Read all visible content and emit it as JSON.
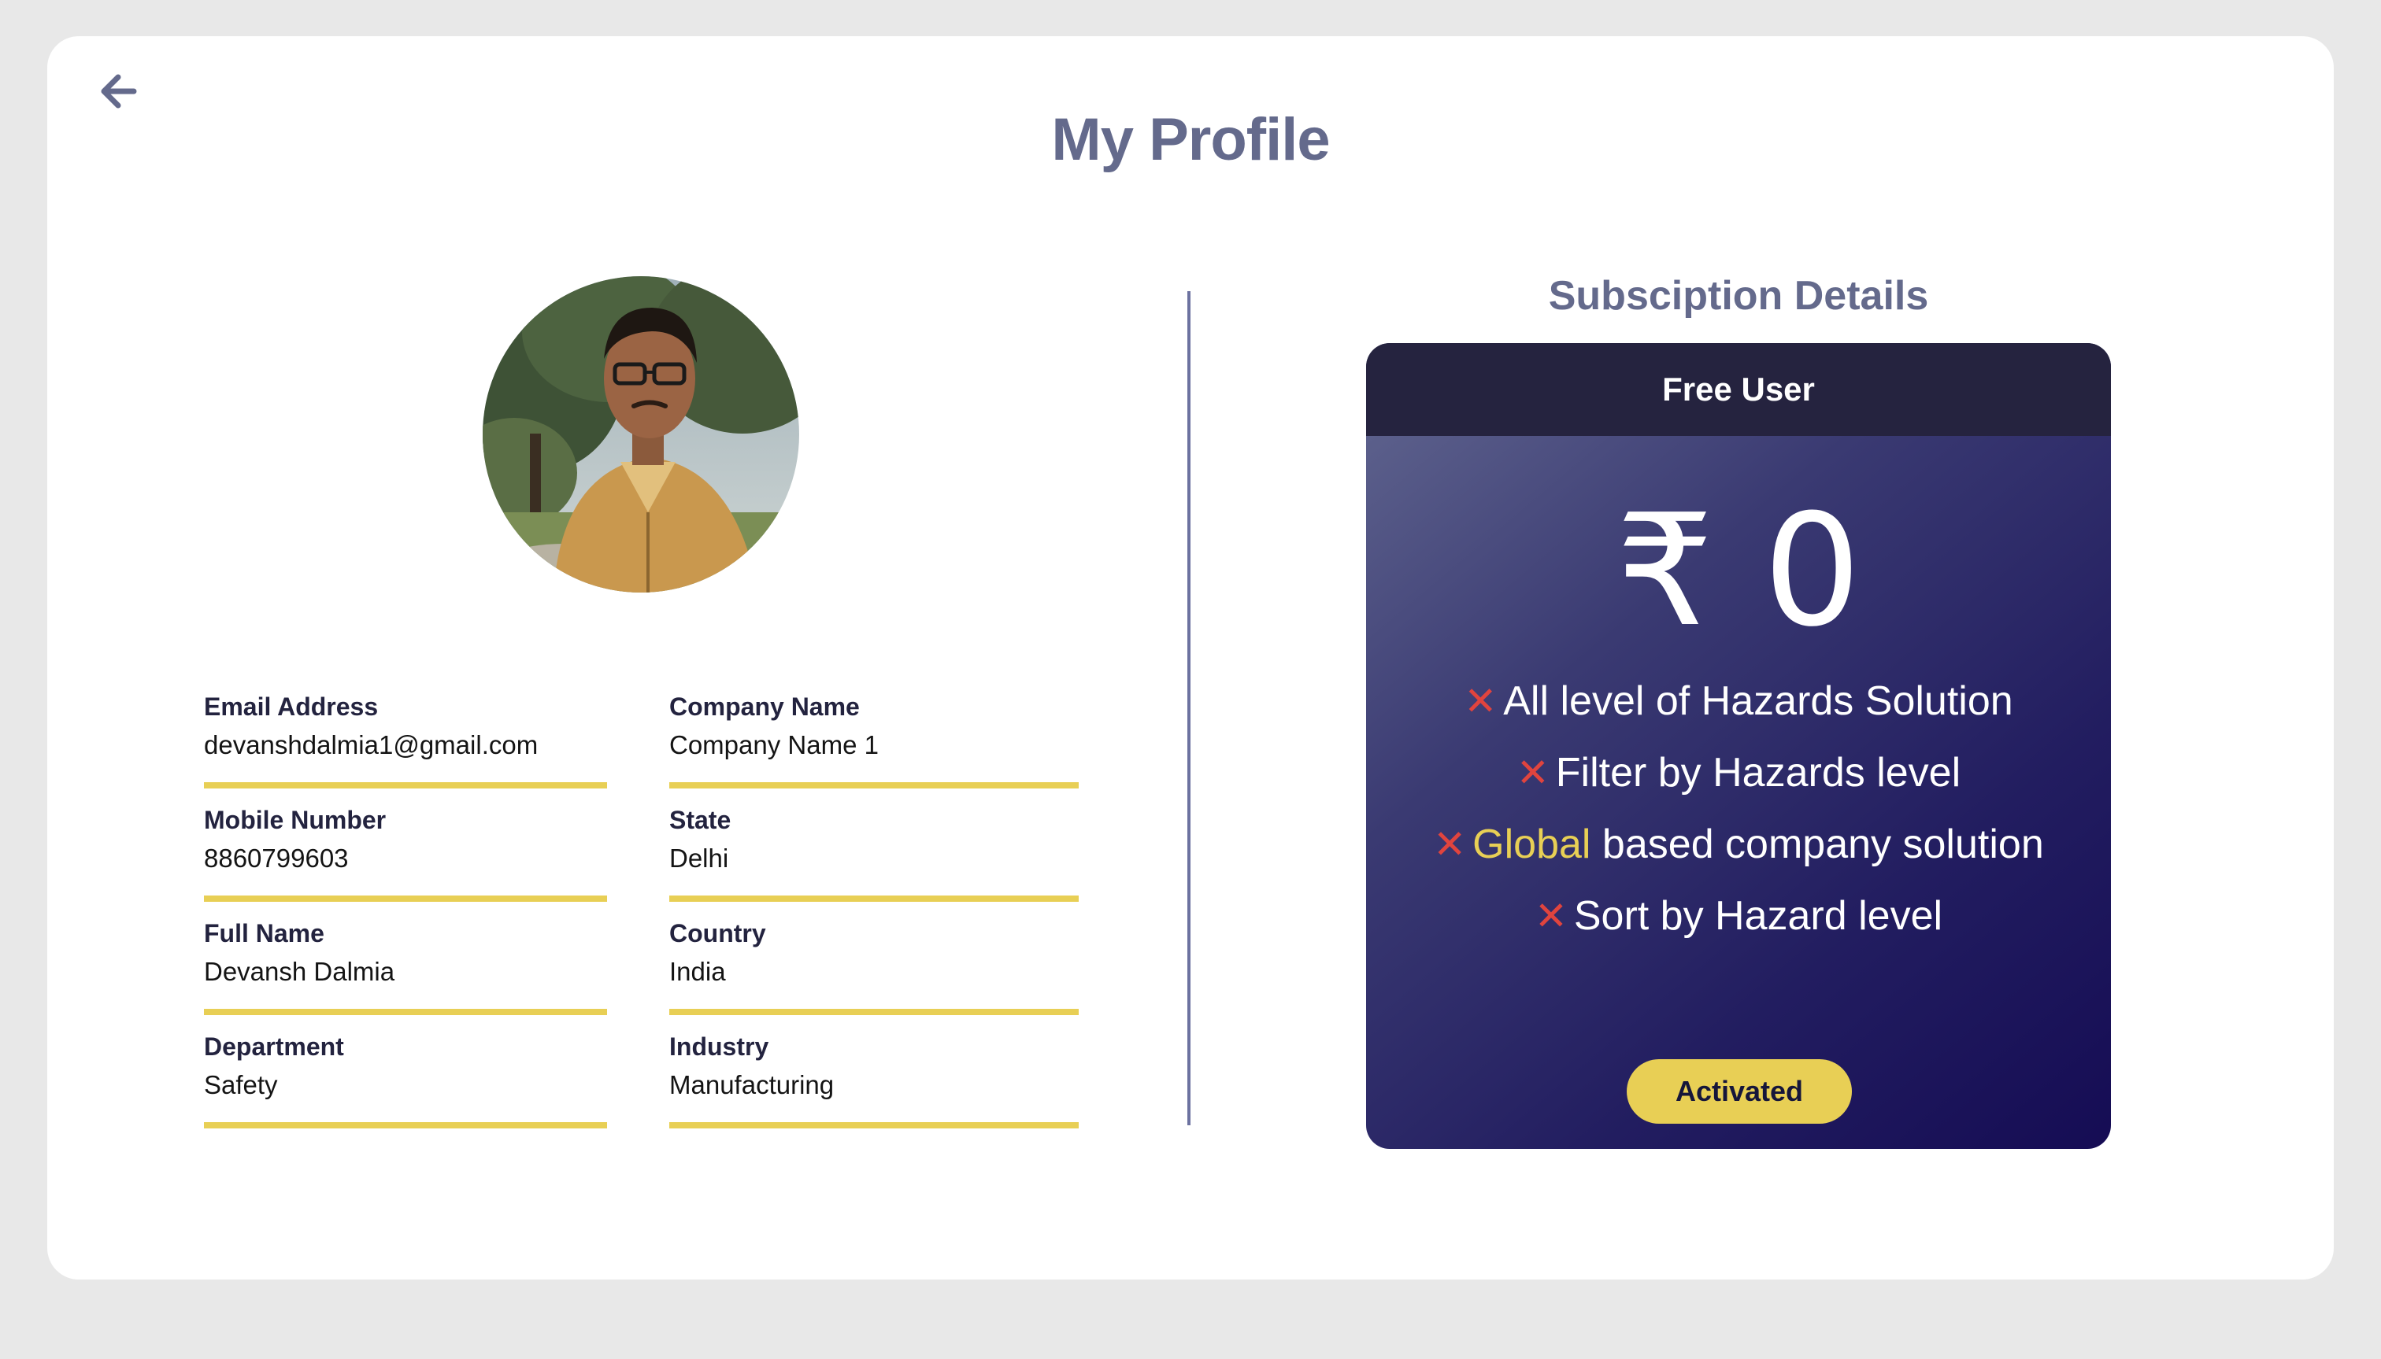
{
  "page": {
    "title": "My Profile",
    "back_icon": "arrow-left-icon"
  },
  "profile": {
    "avatar_icon": "user-photo",
    "fields": [
      {
        "label": "Email Address",
        "value": "devanshdalmia1@gmail.com"
      },
      {
        "label": "Company Name",
        "value": "Company Name 1"
      },
      {
        "label": "Mobile Number",
        "value": "8860799603"
      },
      {
        "label": "State",
        "value": "Delhi"
      },
      {
        "label": "Full Name",
        "value": "Devansh Dalmia"
      },
      {
        "label": "Country",
        "value": "India"
      },
      {
        "label": "Department",
        "value": "Safety"
      },
      {
        "label": "Industry",
        "value": "Manufacturing"
      }
    ]
  },
  "subscription": {
    "title": "Subsciption Details",
    "plan_name": "Free User",
    "price": "₹ 0",
    "features": [
      {
        "prefix": "All level of Hazards Solution",
        "highlight": "",
        "suffix": ""
      },
      {
        "prefix": "Filter by Hazards level",
        "highlight": "",
        "suffix": ""
      },
      {
        "prefix": "",
        "highlight": "Global",
        "suffix": " based company solution"
      },
      {
        "prefix": "Sort by Hazard level",
        "highlight": "",
        "suffix": ""
      }
    ],
    "feature_icon": "cross-icon",
    "status_button": "Activated"
  },
  "colors": {
    "accent_yellow": "#e8cf55",
    "title_gray_blue": "#646a8c",
    "cross_red": "#e0443e",
    "plan_header": "#25233f"
  }
}
